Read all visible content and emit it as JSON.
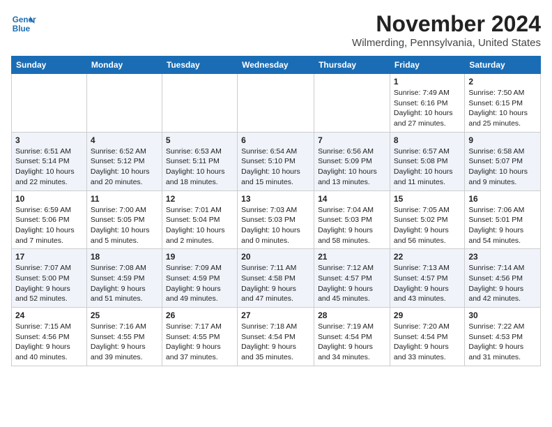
{
  "logo": {
    "line1": "General",
    "line2": "Blue"
  },
  "title": "November 2024",
  "location": "Wilmerding, Pennsylvania, United States",
  "headers": [
    "Sunday",
    "Monday",
    "Tuesday",
    "Wednesday",
    "Thursday",
    "Friday",
    "Saturday"
  ],
  "weeks": [
    [
      {
        "day": "",
        "content": ""
      },
      {
        "day": "",
        "content": ""
      },
      {
        "day": "",
        "content": ""
      },
      {
        "day": "",
        "content": ""
      },
      {
        "day": "",
        "content": ""
      },
      {
        "day": "1",
        "content": "Sunrise: 7:49 AM\nSunset: 6:16 PM\nDaylight: 10 hours\nand 27 minutes."
      },
      {
        "day": "2",
        "content": "Sunrise: 7:50 AM\nSunset: 6:15 PM\nDaylight: 10 hours\nand 25 minutes."
      }
    ],
    [
      {
        "day": "3",
        "content": "Sunrise: 6:51 AM\nSunset: 5:14 PM\nDaylight: 10 hours\nand 22 minutes."
      },
      {
        "day": "4",
        "content": "Sunrise: 6:52 AM\nSunset: 5:12 PM\nDaylight: 10 hours\nand 20 minutes."
      },
      {
        "day": "5",
        "content": "Sunrise: 6:53 AM\nSunset: 5:11 PM\nDaylight: 10 hours\nand 18 minutes."
      },
      {
        "day": "6",
        "content": "Sunrise: 6:54 AM\nSunset: 5:10 PM\nDaylight: 10 hours\nand 15 minutes."
      },
      {
        "day": "7",
        "content": "Sunrise: 6:56 AM\nSunset: 5:09 PM\nDaylight: 10 hours\nand 13 minutes."
      },
      {
        "day": "8",
        "content": "Sunrise: 6:57 AM\nSunset: 5:08 PM\nDaylight: 10 hours\nand 11 minutes."
      },
      {
        "day": "9",
        "content": "Sunrise: 6:58 AM\nSunset: 5:07 PM\nDaylight: 10 hours\nand 9 minutes."
      }
    ],
    [
      {
        "day": "10",
        "content": "Sunrise: 6:59 AM\nSunset: 5:06 PM\nDaylight: 10 hours\nand 7 minutes."
      },
      {
        "day": "11",
        "content": "Sunrise: 7:00 AM\nSunset: 5:05 PM\nDaylight: 10 hours\nand 5 minutes."
      },
      {
        "day": "12",
        "content": "Sunrise: 7:01 AM\nSunset: 5:04 PM\nDaylight: 10 hours\nand 2 minutes."
      },
      {
        "day": "13",
        "content": "Sunrise: 7:03 AM\nSunset: 5:03 PM\nDaylight: 10 hours\nand 0 minutes."
      },
      {
        "day": "14",
        "content": "Sunrise: 7:04 AM\nSunset: 5:03 PM\nDaylight: 9 hours\nand 58 minutes."
      },
      {
        "day": "15",
        "content": "Sunrise: 7:05 AM\nSunset: 5:02 PM\nDaylight: 9 hours\nand 56 minutes."
      },
      {
        "day": "16",
        "content": "Sunrise: 7:06 AM\nSunset: 5:01 PM\nDaylight: 9 hours\nand 54 minutes."
      }
    ],
    [
      {
        "day": "17",
        "content": "Sunrise: 7:07 AM\nSunset: 5:00 PM\nDaylight: 9 hours\nand 52 minutes."
      },
      {
        "day": "18",
        "content": "Sunrise: 7:08 AM\nSunset: 4:59 PM\nDaylight: 9 hours\nand 51 minutes."
      },
      {
        "day": "19",
        "content": "Sunrise: 7:09 AM\nSunset: 4:59 PM\nDaylight: 9 hours\nand 49 minutes."
      },
      {
        "day": "20",
        "content": "Sunrise: 7:11 AM\nSunset: 4:58 PM\nDaylight: 9 hours\nand 47 minutes."
      },
      {
        "day": "21",
        "content": "Sunrise: 7:12 AM\nSunset: 4:57 PM\nDaylight: 9 hours\nand 45 minutes."
      },
      {
        "day": "22",
        "content": "Sunrise: 7:13 AM\nSunset: 4:57 PM\nDaylight: 9 hours\nand 43 minutes."
      },
      {
        "day": "23",
        "content": "Sunrise: 7:14 AM\nSunset: 4:56 PM\nDaylight: 9 hours\nand 42 minutes."
      }
    ],
    [
      {
        "day": "24",
        "content": "Sunrise: 7:15 AM\nSunset: 4:56 PM\nDaylight: 9 hours\nand 40 minutes."
      },
      {
        "day": "25",
        "content": "Sunrise: 7:16 AM\nSunset: 4:55 PM\nDaylight: 9 hours\nand 39 minutes."
      },
      {
        "day": "26",
        "content": "Sunrise: 7:17 AM\nSunset: 4:55 PM\nDaylight: 9 hours\nand 37 minutes."
      },
      {
        "day": "27",
        "content": "Sunrise: 7:18 AM\nSunset: 4:54 PM\nDaylight: 9 hours\nand 35 minutes."
      },
      {
        "day": "28",
        "content": "Sunrise: 7:19 AM\nSunset: 4:54 PM\nDaylight: 9 hours\nand 34 minutes."
      },
      {
        "day": "29",
        "content": "Sunrise: 7:20 AM\nSunset: 4:54 PM\nDaylight: 9 hours\nand 33 minutes."
      },
      {
        "day": "30",
        "content": "Sunrise: 7:22 AM\nSunset: 4:53 PM\nDaylight: 9 hours\nand 31 minutes."
      }
    ]
  ]
}
